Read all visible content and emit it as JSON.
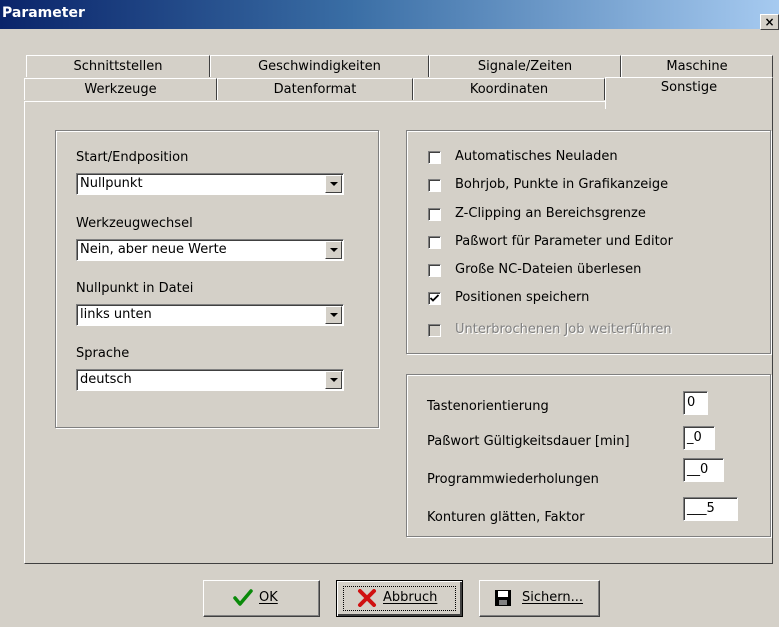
{
  "window": {
    "title": "Parameter",
    "close_glyph": "×"
  },
  "tabs": {
    "row1": [
      "Schnittstellen",
      "Geschwindigkeiten",
      "Signale/Zeiten",
      "Maschine"
    ],
    "row2": [
      "Werkzeuge",
      "Datenformat",
      "Koordinaten",
      "Sonstige"
    ],
    "active": "Sonstige"
  },
  "left_group": {
    "fields": [
      {
        "label": "Start/Endposition",
        "value": "Nullpunkt"
      },
      {
        "label": "Werkzeugwechsel",
        "value": "Nein, aber neue Werte"
      },
      {
        "label": "Nullpunkt in Datei",
        "value": "links unten"
      },
      {
        "label": "Sprache",
        "value": "deutsch"
      }
    ]
  },
  "options": [
    {
      "label": "Automatisches Neuladen",
      "checked": false,
      "enabled": true
    },
    {
      "label": "Bohrjob, Punkte in Grafikanzeige",
      "checked": false,
      "enabled": true
    },
    {
      "label": "Z-Clipping an Bereichsgrenze",
      "checked": false,
      "enabled": true
    },
    {
      "label": "Paßwort für Parameter und Editor",
      "checked": false,
      "enabled": true
    },
    {
      "label": "Große NC-Dateien überlesen",
      "checked": false,
      "enabled": true
    },
    {
      "label": "Positionen speichern",
      "checked": true,
      "enabled": true
    },
    {
      "label": "Unterbrochenen Job weiterführen",
      "checked": false,
      "enabled": false
    }
  ],
  "numeric": [
    {
      "label": "Tastenorientierung",
      "value": "0"
    },
    {
      "label": "Paßwort Gültigkeitsdauer [min]",
      "value": "_0"
    },
    {
      "label": "Programmwiederholungen",
      "value": "__0"
    },
    {
      "label": "Konturen glätten, Faktor",
      "value": "___5"
    }
  ],
  "buttons": {
    "ok": "OK",
    "cancel": "Abbruch",
    "save": "Sichern..."
  },
  "colors": {
    "title_start": "#0a246a",
    "title_end": "#a6caf0",
    "face": "#d4d0c8"
  }
}
